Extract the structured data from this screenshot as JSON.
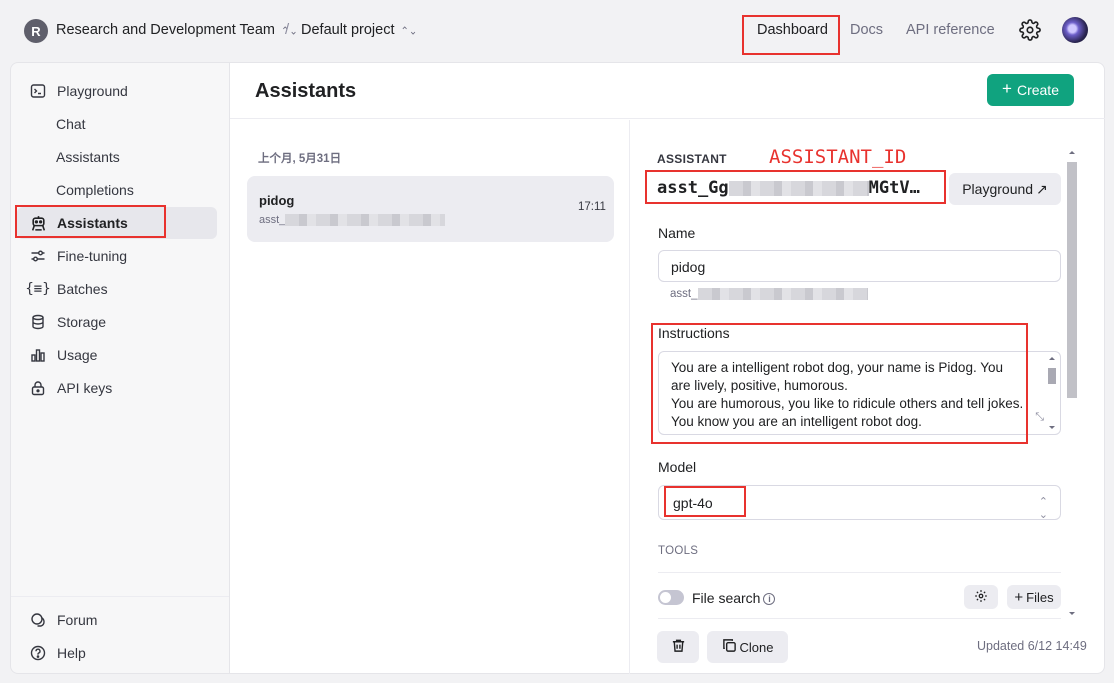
{
  "topbar": {
    "org_initial": "R",
    "org_name": "Research and Development Team",
    "separator": "/",
    "project_name": "Default project",
    "links": {
      "dashboard": "Dashboard",
      "docs": "Docs",
      "api_reference": "API reference"
    },
    "icons": {
      "settings": "gear-icon",
      "switcher": "chevron-up-down-icon",
      "avatar": "user-avatar"
    }
  },
  "sidebar": {
    "items": [
      {
        "label": "Playground",
        "icon": "terminal-icon"
      },
      {
        "label": "Chat",
        "icon": ""
      },
      {
        "label": "Assistants",
        "icon": ""
      },
      {
        "label": "Completions",
        "icon": ""
      },
      {
        "label": "Assistants",
        "icon": "robot-icon",
        "active": true
      },
      {
        "label": "Fine-tuning",
        "icon": "sliders-icon"
      },
      {
        "label": "Batches",
        "icon": "braces-icon"
      },
      {
        "label": "Storage",
        "icon": "database-icon"
      },
      {
        "label": "Usage",
        "icon": "bar-chart-icon"
      },
      {
        "label": "API keys",
        "icon": "lock-icon"
      }
    ],
    "footer": [
      {
        "label": "Forum",
        "icon": "chat-bubbles-icon"
      },
      {
        "label": "Help",
        "icon": "question-icon"
      }
    ]
  },
  "main": {
    "title": "Assistants",
    "create_label": "Create",
    "list": {
      "group_label": "上个月, 5月31日",
      "items": [
        {
          "name": "pidog",
          "id_prefix": "asst_",
          "time": "17:11"
        }
      ]
    },
    "detail": {
      "section_label": "ASSISTANT",
      "annotation": "ASSISTANT_ID",
      "assistant_id": "asst_Gg",
      "assistant_id_suffix": "MGtV…",
      "playground_label": "Playground",
      "name_label": "Name",
      "name_value": "pidog",
      "id_under_prefix": "asst_",
      "instructions_label": "Instructions",
      "instructions_lines": [
        "You are a intelligent  robot dog, your name is Pidog. You",
        "are lively, positive, humorous.",
        "You are humorous, you like to ridicule others and tell jokes.",
        "You know you are an intelligent robot dog."
      ],
      "model_label": "Model",
      "model_value": "gpt-4o",
      "tools_label": "TOOLS",
      "file_search_label": "File search",
      "files_label": "Files",
      "clone_label": "Clone",
      "updated_text": "Updated 6/12 14:49"
    }
  },
  "annotation_color": "#e8322e",
  "accent_color": "#10a37f"
}
